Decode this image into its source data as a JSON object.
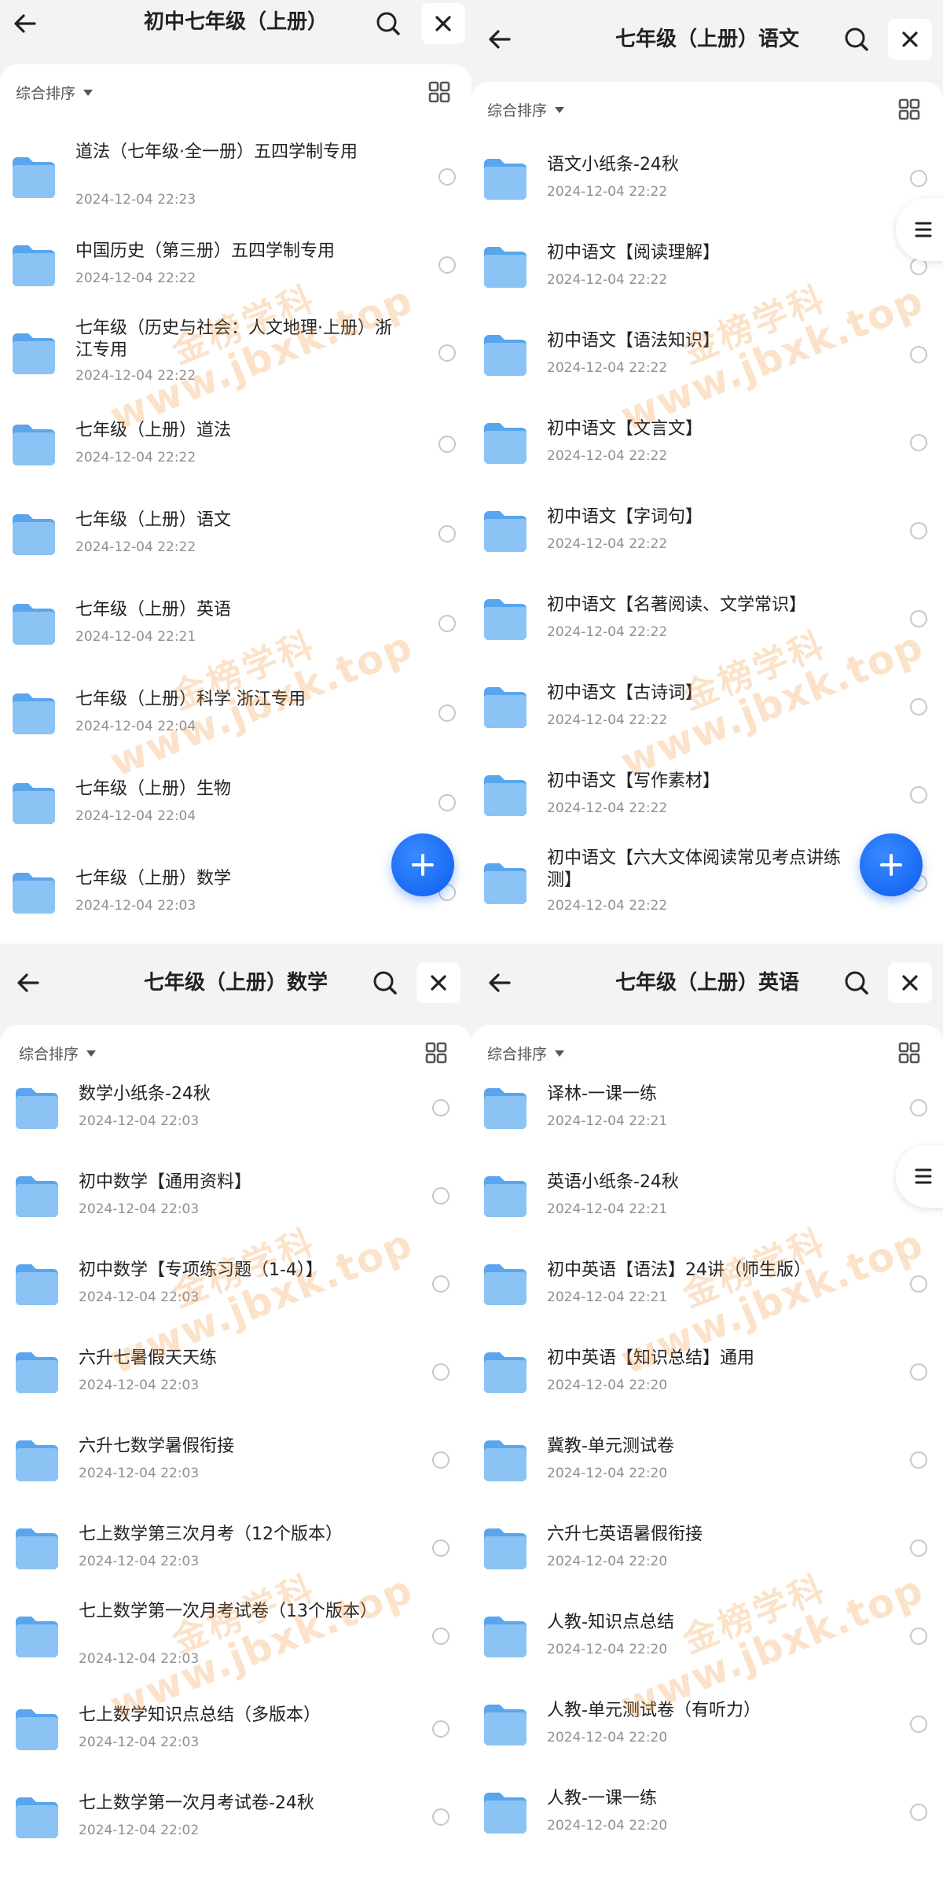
{
  "panels": [
    {
      "title": "初中七年级（上册）",
      "sort_label": "综合排序",
      "items": [
        {
          "name": "道法（七年级·全一册）五四学制专用",
          "date": "2024-12-04 22:23"
        },
        {
          "name": "中国历史（第三册）五四学制专用",
          "date": "2024-12-04 22:22"
        },
        {
          "name": "七年级（历史与社会：人文地理·上册）浙江专用",
          "date": "2024-12-04 22:22"
        },
        {
          "name": "七年级（上册）道法",
          "date": "2024-12-04 22:22"
        },
        {
          "name": "七年级（上册）语文",
          "date": "2024-12-04 22:22"
        },
        {
          "name": "七年级（上册）英语",
          "date": "2024-12-04 22:21"
        },
        {
          "name": "七年级（上册）科学 浙江专用",
          "date": "2024-12-04 22:04"
        },
        {
          "name": "七年级（上册）生物",
          "date": "2024-12-04 22:04"
        },
        {
          "name": "七年级（上册）数学",
          "date": "2024-12-04 22:03"
        }
      ]
    },
    {
      "title": "七年级（上册）语文",
      "sort_label": "综合排序",
      "items": [
        {
          "name": "语文小纸条-24秋",
          "date": "2024-12-04 22:22"
        },
        {
          "name": "初中语文【阅读理解】",
          "date": "2024-12-04 22:22"
        },
        {
          "name": "初中语文【语法知识】",
          "date": "2024-12-04 22:22"
        },
        {
          "name": "初中语文【文言文】",
          "date": "2024-12-04 22:22"
        },
        {
          "name": "初中语文【字词句】",
          "date": "2024-12-04 22:22"
        },
        {
          "name": "初中语文【名著阅读、文学常识】",
          "date": "2024-12-04 22:22"
        },
        {
          "name": "初中语文【古诗词】",
          "date": "2024-12-04 22:22"
        },
        {
          "name": "初中语文【写作素材】",
          "date": "2024-12-04 22:22"
        },
        {
          "name": "初中语文【六大文体阅读常见考点讲练测】",
          "date": "2024-12-04 22:22"
        }
      ]
    },
    {
      "title": "七年级（上册）数学",
      "sort_label": "综合排序",
      "items": [
        {
          "name": "数学小纸条-24秋",
          "date": "2024-12-04 22:03"
        },
        {
          "name": "初中数学【通用资料】",
          "date": "2024-12-04 22:03"
        },
        {
          "name": "初中数学【专项练习题（1-4）】",
          "date": "2024-12-04 22:03"
        },
        {
          "name": "六升七暑假天天练",
          "date": "2024-12-04 22:03"
        },
        {
          "name": "六升七数学暑假衔接",
          "date": "2024-12-04 22:03"
        },
        {
          "name": "七上数学第三次月考（12个版本）",
          "date": "2024-12-04 22:03"
        },
        {
          "name": "七上数学第一次月考试卷（13个版本）",
          "date": "2024-12-04 22:03"
        },
        {
          "name": "七上数学知识点总结（多版本）",
          "date": "2024-12-04 22:03"
        },
        {
          "name": "七上数学第一次月考试卷-24秋",
          "date": "2024-12-04 22:02"
        }
      ]
    },
    {
      "title": "七年级（上册）英语",
      "sort_label": "综合排序",
      "items": [
        {
          "name": "译林-一课一练",
          "date": "2024-12-04 22:21"
        },
        {
          "name": "英语小纸条-24秋",
          "date": "2024-12-04 22:21"
        },
        {
          "name": "初中英语【语法】24讲（师生版）",
          "date": "2024-12-04 22:21"
        },
        {
          "name": "初中英语【知识总结】通用",
          "date": "2024-12-04 22:20"
        },
        {
          "name": "冀教-单元测试卷",
          "date": "2024-12-04 22:20"
        },
        {
          "name": "六升七英语暑假衔接",
          "date": "2024-12-04 22:20"
        },
        {
          "name": "人教-知识点总结",
          "date": "2024-12-04 22:20"
        },
        {
          "name": "人教-单元测试卷（有听力）",
          "date": "2024-12-04 22:20"
        },
        {
          "name": "人教-一课一练",
          "date": "2024-12-04 22:20"
        }
      ]
    }
  ],
  "watermark": {
    "line1": "金榜学科",
    "line2": "www.jbxk.top"
  },
  "icons": {
    "back": "back-arrow-icon",
    "search": "search-icon",
    "close": "close-icon",
    "grid": "grid-view-icon",
    "folder": "folder-icon",
    "add": "plus-icon",
    "menu": "menu-icon"
  },
  "colors": {
    "accent": "#1166f5",
    "folder_top": "#8cc3f5",
    "folder_bottom": "#5aa5ee",
    "date": "#8f8f8f"
  }
}
